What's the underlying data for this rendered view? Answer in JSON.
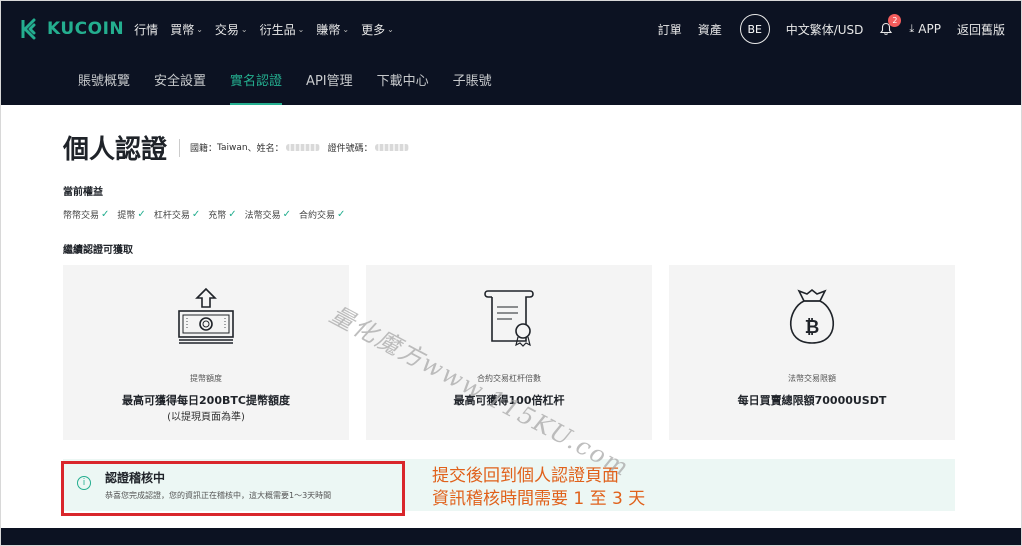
{
  "brand": {
    "name": "KUCOIN",
    "accent": "#24ae8f",
    "header_bg": "#0c1222"
  },
  "main_nav": [
    {
      "label": "行情",
      "dropdown": false
    },
    {
      "label": "買幣",
      "dropdown": true
    },
    {
      "label": "交易",
      "dropdown": true
    },
    {
      "label": "衍生品",
      "dropdown": true
    },
    {
      "label": "賺幣",
      "dropdown": true
    },
    {
      "label": "更多",
      "dropdown": true
    }
  ],
  "right_nav": {
    "orders": "訂單",
    "assets": "資產",
    "avatar": "BE",
    "locale": "中文繁体/USD",
    "notifications_count": "2",
    "app": "APP",
    "old_version": "返回舊版"
  },
  "sub_nav": [
    {
      "label": "賬號概覽",
      "active": false
    },
    {
      "label": "安全設置",
      "active": false
    },
    {
      "label": "實名認證",
      "active": true
    },
    {
      "label": "API管理",
      "active": false
    },
    {
      "label": "下載中心",
      "active": false
    },
    {
      "label": "子賬號",
      "active": false
    }
  ],
  "page": {
    "title": "個人認證",
    "nationality_label": "國籍：",
    "nationality_value": "Taiwan",
    "name_label": "、姓名：",
    "id_label": "證件號碼："
  },
  "current_rights": {
    "label": "當前權益",
    "items": [
      "幣幣交易",
      "提幣",
      "杠杆交易",
      "充幣",
      "法幣交易",
      "合約交易"
    ]
  },
  "more_rights": {
    "label": "繼續認證可獲取",
    "cards": [
      {
        "icon": "money-withdraw-icon",
        "small": "提幣額度",
        "big": "最高可獲得每日200BTC提幣額度",
        "sub": "(以提現頁面為準)"
      },
      {
        "icon": "certificate-icon",
        "small": "合約交易杠杆倍數",
        "big": "最高可獲得100倍杠杆",
        "sub": ""
      },
      {
        "icon": "bitcoin-bag-icon",
        "small": "法幣交易限額",
        "big": "每日買賣總限額70000USDT",
        "sub": ""
      }
    ]
  },
  "status": {
    "title": "認證稽核中",
    "desc": "恭喜您完成認證，您的資訊正在稽核中，這大概需要1～3天時間"
  },
  "annotation": {
    "line1": "提交後回到個人認證頁面",
    "line2": "資訊稽核時間需要 1 至 3 天"
  },
  "watermark": "量化魔方www.115KU.com"
}
